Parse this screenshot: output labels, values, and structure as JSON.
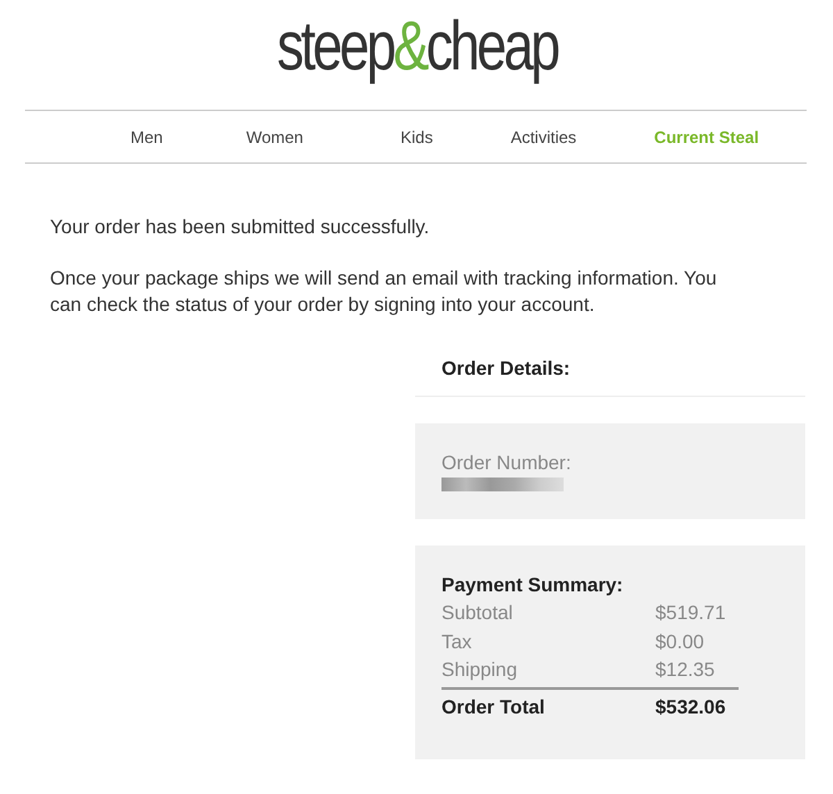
{
  "logo": {
    "before": "steep",
    "mark": "&",
    "after": "cheap"
  },
  "nav": [
    {
      "label": "Men",
      "selected": false
    },
    {
      "label": "Women",
      "selected": false
    },
    {
      "label": "Kids",
      "selected": false
    },
    {
      "label": "Activities",
      "selected": false
    },
    {
      "label": "Current Steal",
      "selected": true
    }
  ],
  "messages": [
    "Your order has been submitted successfully.",
    "Once your package ships we will send an email with tracking information. You can check the status of your order by signing into your account."
  ],
  "order_details": {
    "title": "Order Details:",
    "order_number_label": "Order Number:"
  },
  "payment_summary": {
    "title": "Payment Summary:",
    "rows": [
      {
        "label": "Subtotal",
        "value": "$519.71"
      },
      {
        "label": "Tax",
        "value": "$0.00"
      },
      {
        "label": "Shipping",
        "value": "$12.35"
      }
    ],
    "total": {
      "label": "Order Total",
      "value": "$532.06"
    }
  }
}
